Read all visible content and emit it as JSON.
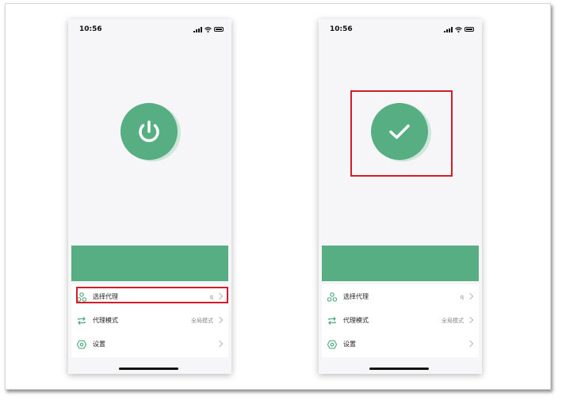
{
  "colors": {
    "accent": "#56ae82",
    "highlight": "#d21e2b"
  },
  "phones": [
    {
      "status_time": "10:56",
      "connect_icon": "power-icon",
      "menu": [
        {
          "icon": "nodes-icon",
          "label": "选择代理",
          "value": "q"
        },
        {
          "icon": "swap-arrows-icon",
          "label": "代理模式",
          "value": "全局模式"
        },
        {
          "icon": "gear-hexagon-icon",
          "label": "设置",
          "value": ""
        }
      ]
    },
    {
      "status_time": "10:56",
      "connect_icon": "checkmark-icon",
      "menu": [
        {
          "icon": "nodes-icon",
          "label": "选择代理",
          "value": "q"
        },
        {
          "icon": "swap-arrows-icon",
          "label": "代理模式",
          "value": "全局模式"
        },
        {
          "icon": "gear-hexagon-icon",
          "label": "设置",
          "value": ""
        }
      ]
    }
  ]
}
